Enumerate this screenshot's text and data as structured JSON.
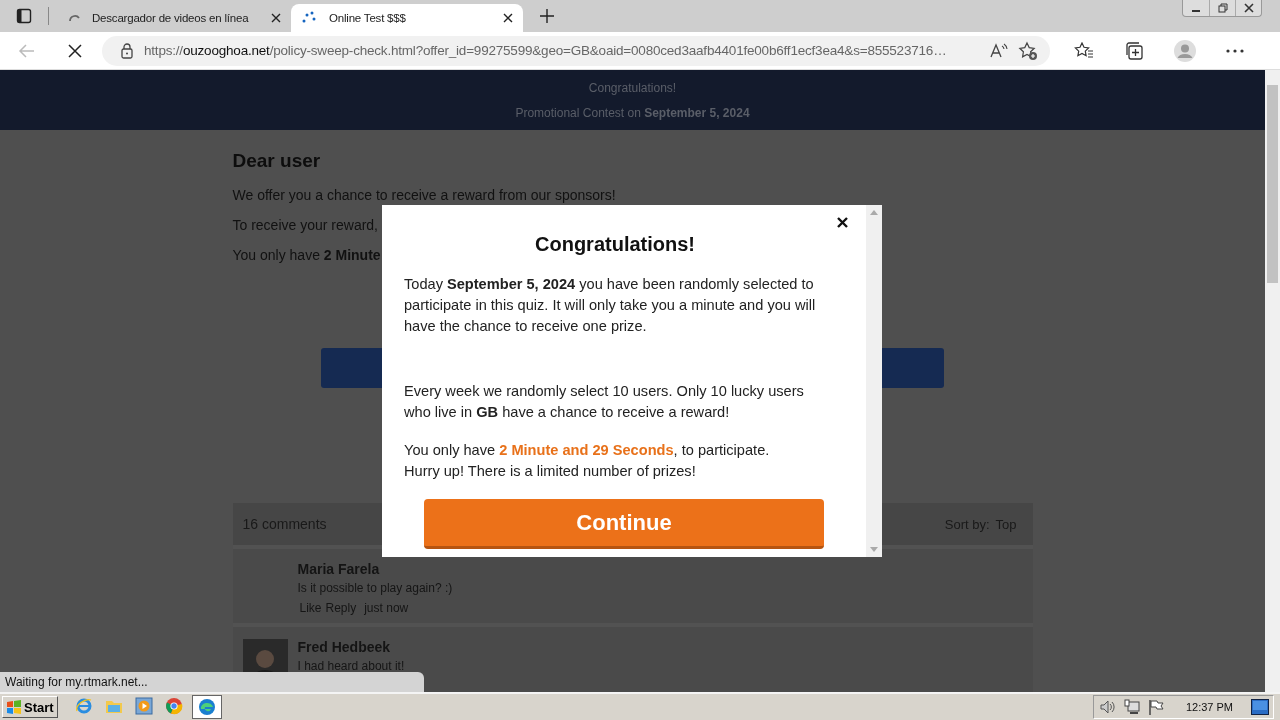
{
  "browser": {
    "tabs": [
      {
        "title": "Descargador de videos en línea",
        "kind": "spinner",
        "selected": false
      },
      {
        "title": "Online Test $$$",
        "kind": "dots",
        "selected": true
      }
    ],
    "address": {
      "scheme": "https://",
      "host": "ouzooghoa.net",
      "rest": "/policy-sweep-check.html?offer_id=99275599&geo=GB&oaid=0080ced3aafb4401fe00b6ff1ecf3ea4&s=855523716…"
    },
    "status_text": "Waiting for my.rtmark.net..."
  },
  "page": {
    "header": {
      "title": "Congratulations!",
      "subtitle": "Promotional Contest on **September 5, 2024**"
    },
    "heading": "Dear user",
    "paragraphs": [
      "We offer you a chance to receive a reward from our sponsors!",
      "To receive your reward,",
      "You only have **2 Minute**"
    ],
    "comments": {
      "count": "16 comments",
      "sort_label": "Sort by:",
      "sort_value": "Top",
      "items": [
        {
          "author": "Maria Farela",
          "text": "Is it possible to play again? :)",
          "actions": [
            "Like",
            "Reply"
          ],
          "time": "just now",
          "avatar": false
        },
        {
          "author": "Fred Hedbeek",
          "text": "I had heard about it!",
          "avatar": true
        }
      ]
    }
  },
  "modal": {
    "title": "Congratulations!",
    "paragraphs": [
      "Today **September 5, 2024** you have been randomly selected to participate in this quiz. It will only take you a minute and you will have the chance to receive one prize.",
      "Every week we randomly select 10 users. Only 10 lucky users who live in **GB** have a chance to receive a reward!"
    ],
    "timer": {
      "before": "You only have ",
      "highlight": "2 Minute and 29 Seconds",
      "after": ", to participate."
    },
    "hurry": "Hurry up! There is a limited number of prizes!",
    "button": "Continue"
  },
  "taskbar": {
    "start": "Start",
    "apps": [
      {
        "kind": "ie",
        "selected": false
      },
      {
        "kind": "folder",
        "selected": false
      },
      {
        "kind": "media",
        "selected": false
      },
      {
        "kind": "chrome",
        "selected": false
      },
      {
        "kind": "edge",
        "selected": true
      }
    ],
    "clock": "12:37 PM"
  }
}
